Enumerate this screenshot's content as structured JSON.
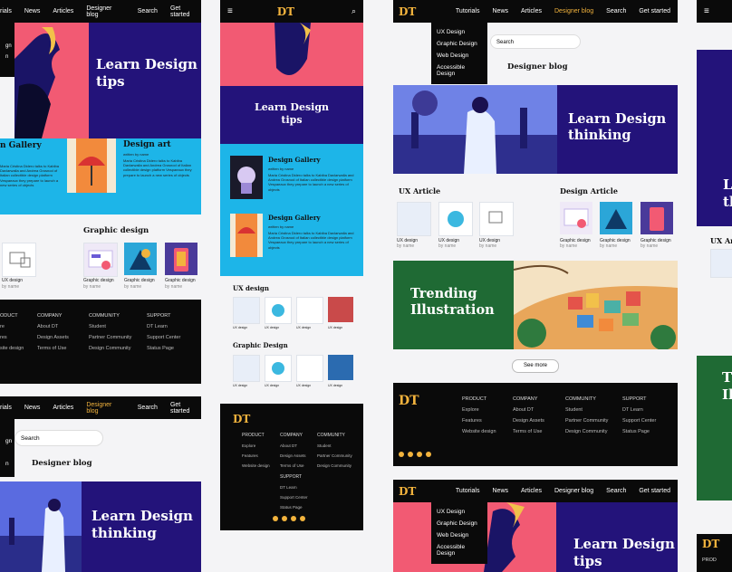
{
  "nav": {
    "logo": "DT",
    "tutorials": "Tutorials",
    "news": "News",
    "articles": "Articles",
    "designer_blog": "Designer blog",
    "search": "Search",
    "get_started": "Get started"
  },
  "dropdown": [
    "UX Design",
    "Graphic Design",
    "Web Design",
    "Accessible Design"
  ],
  "dropdown_partial": [
    "rials",
    "gn",
    "n"
  ],
  "search_placeholder": "Search",
  "designer_blog_heading": "Designer blog",
  "hero": {
    "design_tips": "Learn Design tips",
    "design_tips_l1": "Learn Design",
    "design_tips_l2": "tips",
    "thinking_l1": "Learn Design",
    "thinking_l2": "thinking"
  },
  "gallery": {
    "title_partial": "n Gallery",
    "design_gallery": "Design Gallery",
    "design_art": "Design art",
    "written_by": "written by name",
    "body": "Maria Cristina Didero talks to Kabiba Davlarwalla and Andrea Grosnod of Italian collectible design platform Vespaeaux they prepare to launch a new series of objects",
    "body_partial": "Maria Cristina Didero talks to Kabiba Davlarwalla and Andrea Grosnod of Italian collectible design platform Vespaeaux they prepare to launch a new series of objects"
  },
  "graphic_design": "Graphic design",
  "graphic_design_heading2": "Graphic Design",
  "ux_design_heading": "UX design",
  "ux_article": "UX Article",
  "design_article": "Design Article",
  "card_labels": {
    "ux_design": "UX design",
    "graphic_design": "Graphic design",
    "by_name": "by name"
  },
  "trending": {
    "line1": "Trending",
    "line2": "Illustration"
  },
  "see_more": "See more",
  "footer": {
    "logo": "DT",
    "product": "PRODUCT",
    "company": "COMPANY",
    "community": "COMMUNITY",
    "support": "SUPPORT",
    "product_items": [
      "Explore",
      "Features",
      "Website design"
    ],
    "company_items": [
      "About DT",
      "Design Assets",
      "Terms of Use"
    ],
    "community_items": [
      "Student",
      "Partner Community",
      "Design Community"
    ],
    "support_items": [
      "DT Learn",
      "Support Center",
      "Status Page"
    ],
    "partial_product": "ODUCT",
    "partial_items": [
      "re",
      "res",
      "site design"
    ],
    "partial_far": "PROD"
  },
  "far_right": {
    "hero_partial": "L",
    "hero_partial2": "tl",
    "ux_partial": "UX Art",
    "trending_partial": "T",
    "trending_partial2": "Il"
  },
  "colors": {
    "navy": "#23137a",
    "pink": "#f25a73",
    "cyan": "#1db5e8",
    "green": "#1f6a34",
    "accent": "#f2b33d"
  }
}
